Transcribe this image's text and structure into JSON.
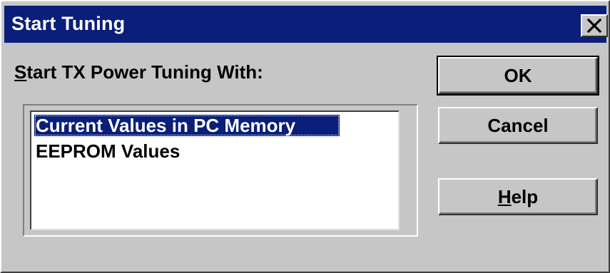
{
  "window": {
    "title": "Start Tuning",
    "close_glyph": "✕"
  },
  "prompt": {
    "mnemonic": "S",
    "rest": "tart TX Power Tuning With:"
  },
  "listbox": {
    "items": [
      {
        "label": "Current Values in PC Memory",
        "selected": true
      },
      {
        "label": "EEPROM Values",
        "selected": false
      }
    ]
  },
  "buttons": {
    "ok": {
      "label": "OK"
    },
    "cancel": {
      "label": "Cancel"
    },
    "help": {
      "mnemonic": "H",
      "rest": "elp"
    }
  },
  "colors": {
    "titlebar": "#0a1e7a",
    "face": "#c6c6c6",
    "selection": "#0a1e7a"
  }
}
